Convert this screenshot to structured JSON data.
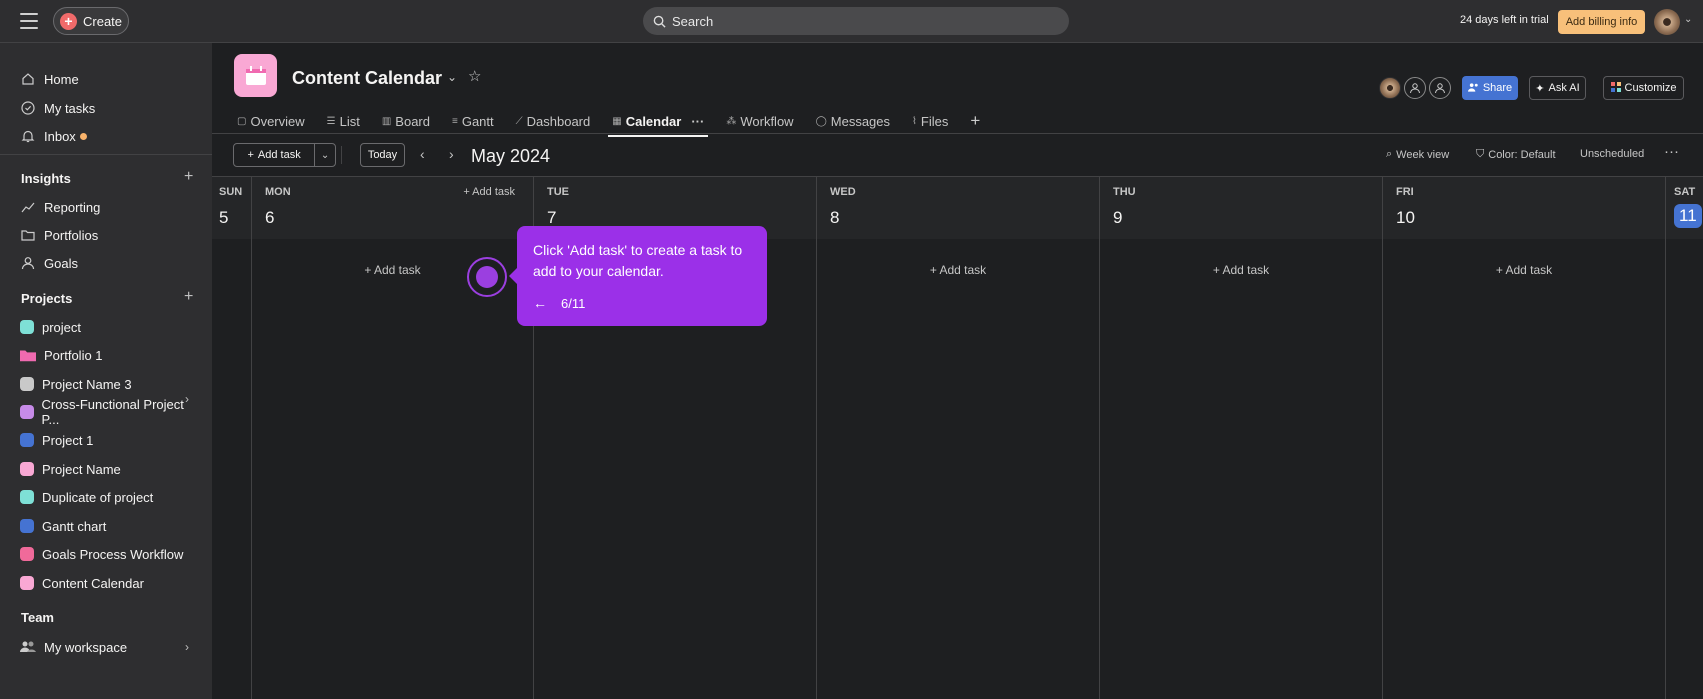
{
  "topbar": {
    "create_label": "Create",
    "search_placeholder": "Search",
    "trial_text": "24 days left in trial",
    "billing_label": "Add billing info"
  },
  "sidebar": {
    "nav": [
      {
        "label": "Home",
        "icon": "home-icon"
      },
      {
        "label": "My tasks",
        "icon": "check-circle-icon"
      },
      {
        "label": "Inbox",
        "icon": "bell-icon"
      }
    ],
    "insights_title": "Insights",
    "insights": [
      {
        "label": "Reporting",
        "icon": "chart-line-icon"
      },
      {
        "label": "Portfolios",
        "icon": "folder-icon"
      },
      {
        "label": "Goals",
        "icon": "person-icon"
      }
    ],
    "projects_title": "Projects",
    "projects": [
      {
        "label": "project",
        "color": "#7ee0d6"
      },
      {
        "label": "Portfolio 1",
        "color": "#f06ab0"
      },
      {
        "label": "Project Name 3",
        "color": "#c9c9c9"
      },
      {
        "label": "Cross-Functional Project P...",
        "color": "#c78be8"
      },
      {
        "label": "Project 1",
        "color": "#4573d2"
      },
      {
        "label": "Project Name",
        "color": "#f9a8d4"
      },
      {
        "label": "Duplicate of project",
        "color": "#7ee0d6"
      },
      {
        "label": "Gantt chart",
        "color": "#4573d2"
      },
      {
        "label": "Goals Process Workflow",
        "color": "#f06a9a"
      },
      {
        "label": "Content Calendar",
        "color": "#f9a8d4"
      }
    ],
    "team_title": "Team",
    "team": [
      {
        "label": "My workspace",
        "icon": "people-icon"
      }
    ]
  },
  "project": {
    "title": "Content Calendar",
    "tabs": [
      {
        "label": "Overview",
        "icon": "overview-icon"
      },
      {
        "label": "List",
        "icon": "list-icon"
      },
      {
        "label": "Board",
        "icon": "board-icon"
      },
      {
        "label": "Gantt",
        "icon": "gantt-icon"
      },
      {
        "label": "Dashboard",
        "icon": "dashboard-icon"
      },
      {
        "label": "Calendar",
        "icon": "calendar-icon",
        "active": true
      },
      {
        "label": "Workflow",
        "icon": "workflow-icon"
      },
      {
        "label": "Messages",
        "icon": "message-icon"
      },
      {
        "label": "Files",
        "icon": "paperclip-icon"
      }
    ],
    "share_label": "Share",
    "ask_ai_label": "Ask AI",
    "customize_label": "Customize"
  },
  "toolbar": {
    "add_task_label": "Add task",
    "today_label": "Today",
    "month_label": "May 2024",
    "week_view_label": "Week view",
    "color_label": "Color: Default",
    "unscheduled_label": "Unscheduled"
  },
  "calendar": {
    "days": [
      {
        "dow": "SUN",
        "num": "5"
      },
      {
        "dow": "MON",
        "num": "6",
        "head_add": "+ Add task"
      },
      {
        "dow": "TUE",
        "num": "7"
      },
      {
        "dow": "WED",
        "num": "8"
      },
      {
        "dow": "THU",
        "num": "9"
      },
      {
        "dow": "FRI",
        "num": "10"
      },
      {
        "dow": "SAT",
        "num": "11",
        "today": true
      }
    ],
    "cell_add_label": "+ Add task"
  },
  "tooltip": {
    "text": "Click 'Add task' to create a task to add to your calendar.",
    "back": "←",
    "step": "6/11"
  },
  "colors": {
    "accent_purple": "#9b30e8",
    "share_blue": "#4573d2",
    "billing_orange": "#f8c07a"
  }
}
